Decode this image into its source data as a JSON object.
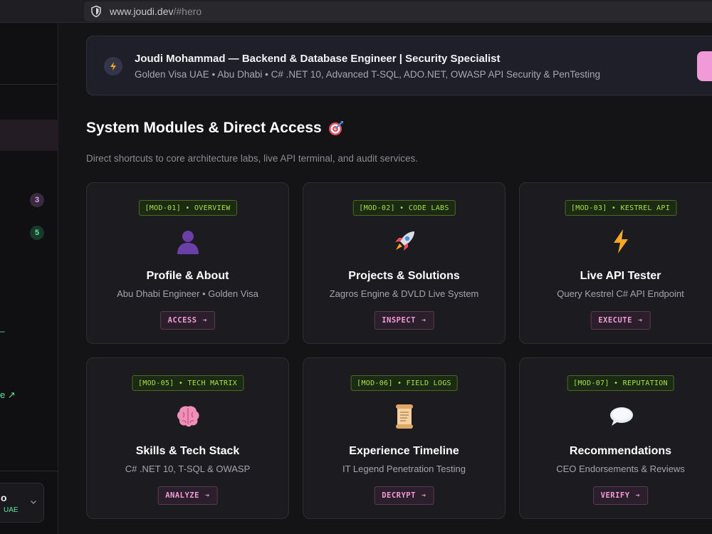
{
  "browser": {
    "url_host": "www.joudi.dev",
    "url_path": "/#hero"
  },
  "sidebar": {
    "badges": [
      "3",
      "5"
    ],
    "dot": "–",
    "link_fragment": "e ↗",
    "user_initial": "o",
    "user_location": "UAE"
  },
  "hero": {
    "title": "Joudi Mohammad — Backend & Database Engineer | Security Specialist",
    "subtitle": "Golden Visa UAE • Abu Dhabi • C# .NET 10, Advanced T-SQL, ADO.NET, OWASP API Security & PenTesting",
    "icon": "lightning-icon"
  },
  "section": {
    "title": "System Modules & Direct Access",
    "title_icon": "target-icon",
    "subtitle": "Direct shortcuts to core architecture labs, live API terminal, and audit services."
  },
  "cards": [
    {
      "tag": "[MOD-01] • OVERVIEW",
      "icon": "person-silhouette-icon",
      "title": "Profile & About",
      "desc": "Abu Dhabi Engineer • Golden Visa",
      "button": "ACCESS"
    },
    {
      "tag": "[MOD-02] • CODE LABS",
      "icon": "rocket-icon",
      "title": "Projects & Solutions",
      "desc": "Zagros Engine & DVLD Live System",
      "button": "INSPECT"
    },
    {
      "tag": "[MOD-03] • KESTREL API",
      "icon": "lightning-icon",
      "title": "Live API Tester",
      "desc": "Query Kestrel C# API Endpoint",
      "button": "EXECUTE"
    },
    {
      "tag": "[MOD-05] • TECH MATRIX",
      "icon": "brain-icon",
      "title": "Skills & Tech Stack",
      "desc": "C# .NET 10, T-SQL & OWASP",
      "button": "ANALYZE"
    },
    {
      "tag": "[MOD-06] • FIELD LOGS",
      "icon": "scroll-icon",
      "title": "Experience Timeline",
      "desc": "IT Legend Penetration Testing",
      "button": "DECRYPT"
    },
    {
      "tag": "[MOD-07] • REPUTATION",
      "icon": "speech-bubble-icon",
      "title": "Recommendations",
      "desc": "CEO Endorsements & Reviews",
      "button": "VERIFY"
    }
  ],
  "arrow": "➔",
  "colors": {
    "accent_pink": "#f29ad8",
    "tag_green": "#a7e04a",
    "success_green": "#5ee59a",
    "background": "#141416"
  }
}
